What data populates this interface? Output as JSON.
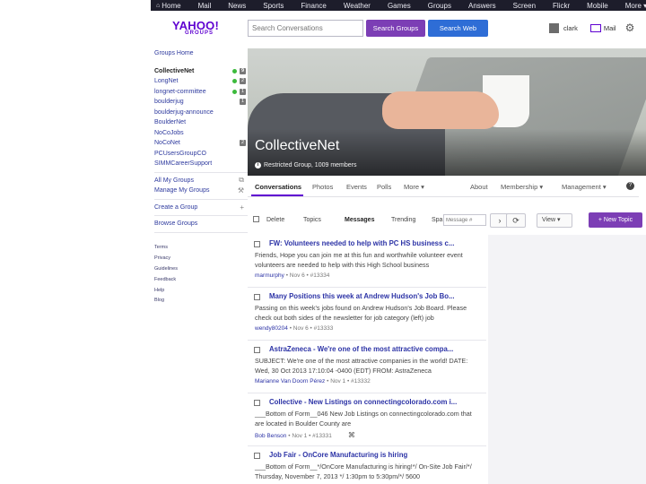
{
  "topnav": [
    {
      "label": "Home",
      "icon": "home-icon"
    },
    {
      "label": "Mail"
    },
    {
      "label": "News"
    },
    {
      "label": "Sports"
    },
    {
      "label": "Finance"
    },
    {
      "label": "Weather"
    },
    {
      "label": "Games"
    },
    {
      "label": "Groups"
    },
    {
      "label": "Answers"
    },
    {
      "label": "Screen"
    },
    {
      "label": "Flickr"
    },
    {
      "label": "Mobile"
    },
    {
      "label": "More ▾"
    }
  ],
  "header": {
    "brand": "YAHOO!",
    "brand_sub": "GROUPS",
    "search_placeholder": "Search Conversations",
    "search_groups_label": "Search Groups",
    "search_web_label": "Search Web",
    "username": "clark",
    "mail_label": "Mail"
  },
  "sidebar": {
    "groups": [
      {
        "label": "Groups Home"
      },
      {
        "label": "CollectiveNet",
        "badge": "9",
        "dot": true,
        "active": true
      },
      {
        "label": "LongNet",
        "badge": "2",
        "dot": true
      },
      {
        "label": "longnet-committee",
        "badge": "1",
        "dot": true
      },
      {
        "label": "boulderjug",
        "badge": "1"
      },
      {
        "label": "boulderjug-announce"
      },
      {
        "label": "BoulderNet"
      },
      {
        "label": "NoCoJobs"
      },
      {
        "label": "NoCoNet",
        "badge": "2"
      },
      {
        "label": "PCUsersGroupCO"
      },
      {
        "label": "SIMMCareerSupport"
      }
    ],
    "actions": [
      {
        "label": "All My Groups",
        "icon": "copy-icon"
      },
      {
        "label": "Manage My Groups",
        "icon": "wrench-icon"
      }
    ],
    "create_group": "Create a Group",
    "browse_groups": "Browse Groups",
    "footer_links": [
      "Terms",
      "Privacy",
      "Guidelines",
      "Feedback",
      "Help",
      "Blog"
    ]
  },
  "cover": {
    "group_name": "CollectiveNet",
    "group_meta": "Restricted Group, 1009 members"
  },
  "tabs": [
    "Conversations",
    "Photos",
    "Events",
    "Polls",
    "More ▾",
    "About",
    "Membership ▾",
    "Management ▾"
  ],
  "toolbar": {
    "delete_label": "Delete",
    "topics_label": "Topics",
    "messages_label": "Messages",
    "trending_label": "Trending",
    "spam_label": "Spa",
    "message_search_placeholder": "Message #",
    "view_label": "View ▾",
    "new_topic_label": "+ New Topic"
  },
  "messages": [
    {
      "subject": "FW: Volunteers needed to help with PC HS business c...",
      "snippet": "Friends, Hope you can join me at this fun and worthwhile volunteer event volunteers are needed to help with this High School business",
      "author": "marmurphy",
      "meta": "• Nov 6 • #13334"
    },
    {
      "subject": "Many Positions this week at Andrew Hudson's Job Bo...",
      "snippet": "Passing on this week's jobs found on Andrew Hudson's Job Board. Please check out both sides of the newsletter for job category (left) job",
      "author": "wendy80204",
      "meta": "• Nov 6 • #13333"
    },
    {
      "subject": "AstraZeneca - We're one of the most attractive compa...",
      "snippet": "SUBJECT: We're one of the most attractive companies in the world! DATE: Wed, 30 Oct 2013 17:10:04 -0400 (EDT) FROM: AstraZeneca",
      "author": "Marianne Van Doorn Pérez",
      "meta": "• Nov 1 • #13332"
    },
    {
      "subject": "Collective - New Listings on connectingcolorado.com i...",
      "snippet": "___Bottom of Form__046 New Job Listings on connectingcolorado.com that are located in Boulder County are",
      "author": "Bob Benson",
      "meta": "• Nov 1 • #13331",
      "attachment": true
    },
    {
      "subject": "Job Fair - OnCore Manufacturing is hiring",
      "snippet": "___Bottom of Form__*/OnCore Manufacturing is hiring!*/ On-Site Job Fair/*/ Thursday, November 7, 2013 */ 1:30pm to 5:30pm/*/ 5600",
      "author": "",
      "meta": ""
    }
  ]
}
